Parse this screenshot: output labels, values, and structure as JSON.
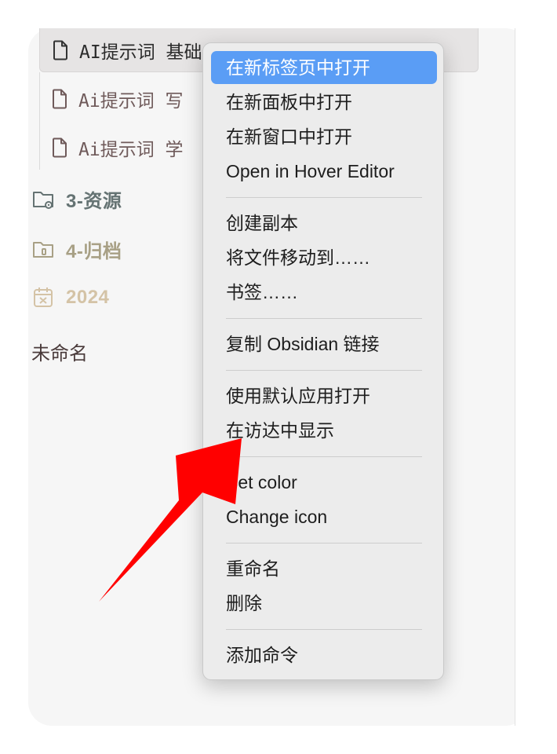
{
  "sidebar": {
    "files": [
      {
        "label": "AI提示词 基础",
        "icon": "file-icon"
      },
      {
        "label": "Ai提示词 写",
        "icon": "file-icon"
      },
      {
        "label": "Ai提示词 学",
        "icon": "file-icon"
      }
    ],
    "folders": [
      {
        "label": "3-资源",
        "icon": "folder-gear-icon",
        "color": "#657373"
      },
      {
        "label": "4-归档",
        "icon": "folder-archive-icon",
        "color": "#a8a085"
      },
      {
        "label": "2024",
        "icon": "calendar-icon",
        "color": "#d4c3a6"
      }
    ],
    "untitled": "未命名"
  },
  "context_menu": {
    "groups": [
      [
        "在新标签页中打开",
        "在新面板中打开",
        "在新窗口中打开",
        "Open in Hover Editor"
      ],
      [
        "创建副本",
        "将文件移动到……",
        "书签……"
      ],
      [
        "复制 Obsidian 链接"
      ],
      [
        "使用默认应用打开",
        "在访达中显示"
      ],
      [
        "Set color",
        "Change icon"
      ],
      [
        "重命名",
        "删除"
      ],
      [
        "添加命令"
      ]
    ],
    "highlighted_item": "在新标签页中打开",
    "highlight_color": "#5a9df5"
  },
  "annotation": {
    "icon": "red-arrow-icon",
    "color": "#ff0000"
  }
}
